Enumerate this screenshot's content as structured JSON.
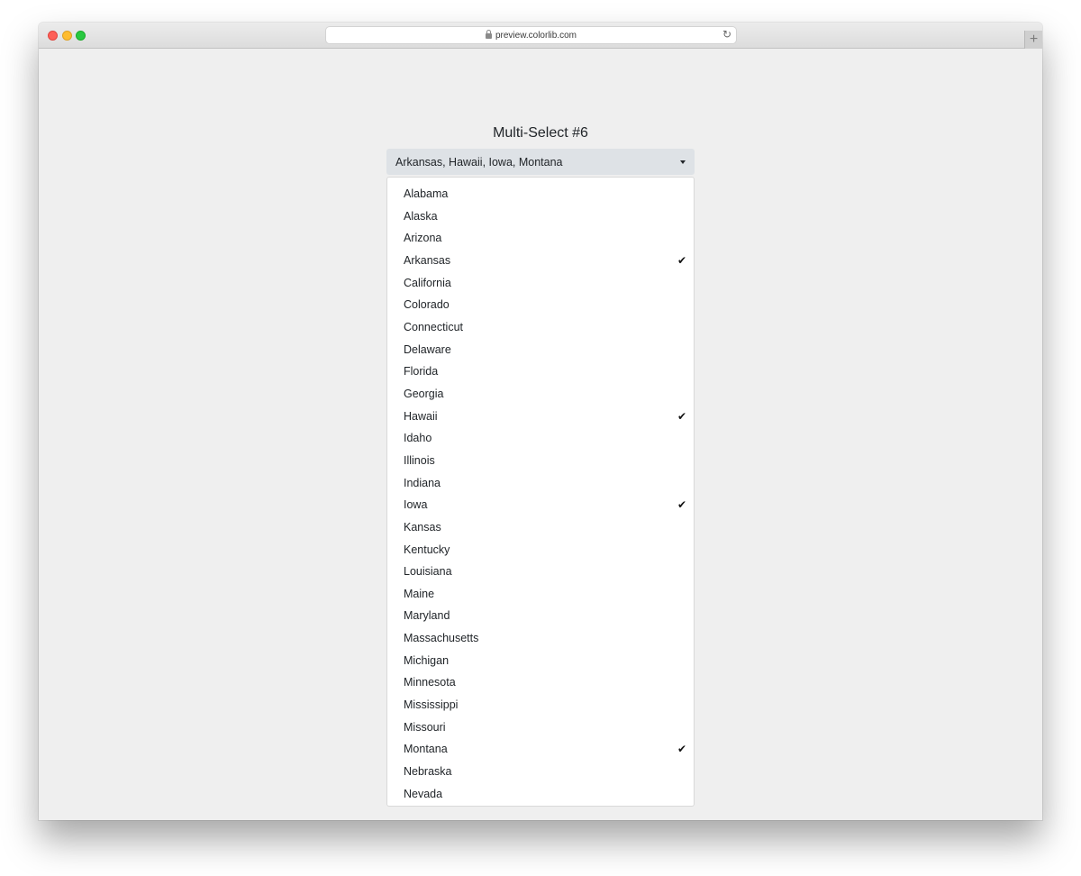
{
  "browser": {
    "url": "preview.colorlib.com",
    "reload_glyph": "↻",
    "new_tab_glyph": "+"
  },
  "page": {
    "title": "Multi-Select #6"
  },
  "select": {
    "value": "Arkansas, Hawaii, Iowa, Montana",
    "check_glyph": "✔",
    "options": [
      {
        "label": "Alabama",
        "selected": false
      },
      {
        "label": "Alaska",
        "selected": false
      },
      {
        "label": "Arizona",
        "selected": false
      },
      {
        "label": "Arkansas",
        "selected": true
      },
      {
        "label": "California",
        "selected": false
      },
      {
        "label": "Colorado",
        "selected": false
      },
      {
        "label": "Connecticut",
        "selected": false
      },
      {
        "label": "Delaware",
        "selected": false
      },
      {
        "label": "Florida",
        "selected": false
      },
      {
        "label": "Georgia",
        "selected": false
      },
      {
        "label": "Hawaii",
        "selected": true
      },
      {
        "label": "Idaho",
        "selected": false
      },
      {
        "label": "Illinois",
        "selected": false
      },
      {
        "label": "Indiana",
        "selected": false
      },
      {
        "label": "Iowa",
        "selected": true
      },
      {
        "label": "Kansas",
        "selected": false
      },
      {
        "label": "Kentucky",
        "selected": false
      },
      {
        "label": "Louisiana",
        "selected": false
      },
      {
        "label": "Maine",
        "selected": false
      },
      {
        "label": "Maryland",
        "selected": false
      },
      {
        "label": "Massachusetts",
        "selected": false
      },
      {
        "label": "Michigan",
        "selected": false
      },
      {
        "label": "Minnesota",
        "selected": false
      },
      {
        "label": "Mississippi",
        "selected": false
      },
      {
        "label": "Missouri",
        "selected": false
      },
      {
        "label": "Montana",
        "selected": true
      },
      {
        "label": "Nebraska",
        "selected": false
      },
      {
        "label": "Nevada",
        "selected": false
      }
    ]
  }
}
